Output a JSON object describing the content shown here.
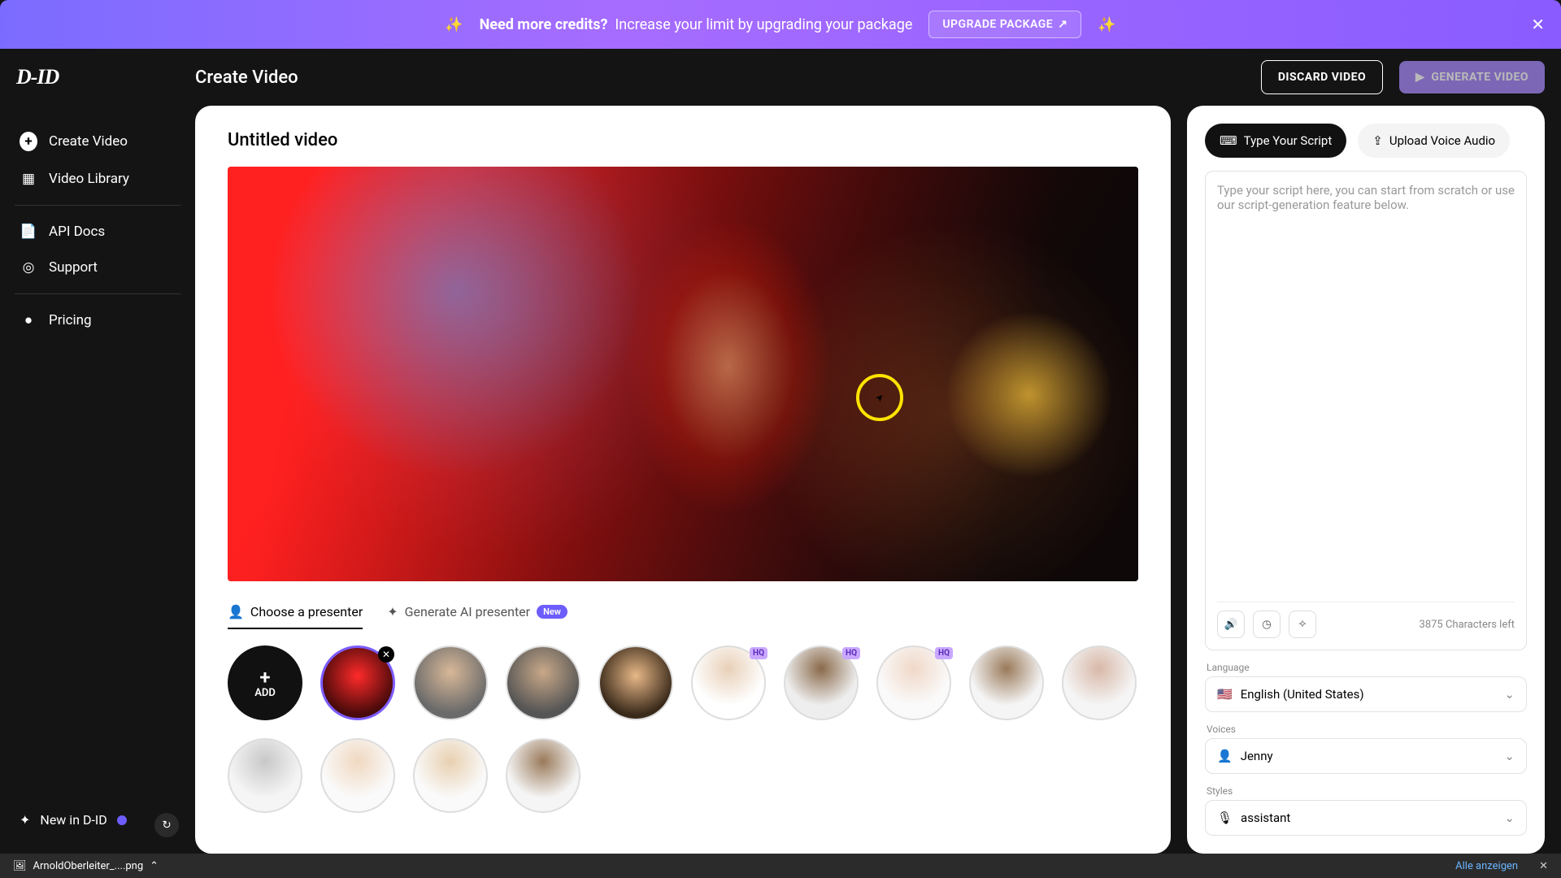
{
  "banner": {
    "bold": "Need more credits?",
    "rest": "Increase your limit by upgrading your package",
    "cta": "UPGRADE PACKAGE"
  },
  "logo": "D-ID",
  "page_title": "Create Video",
  "discard": "DISCARD VIDEO",
  "generate": "GENERATE VIDEO",
  "sidebar": {
    "create": "Create Video",
    "library": "Video Library",
    "api": "API Docs",
    "support": "Support",
    "pricing": "Pricing",
    "new_in": "New in D-ID"
  },
  "main": {
    "title": "Untitled video",
    "tab_choose": "Choose a presenter",
    "tab_generate": "Generate AI presenter",
    "new_pill": "New",
    "add": "ADD",
    "hq": "HQ"
  },
  "right": {
    "type_script": "Type Your Script",
    "upload_audio": "Upload Voice Audio",
    "placeholder": "Type your script here, you can start from scratch or use our script-generation feature below.",
    "chars_left": "3875 Characters left",
    "language_label": "Language",
    "language_value": "English (United States)",
    "flag": "🇺🇸",
    "voices_label": "Voices",
    "voices_value": "Jenny",
    "styles_label": "Styles",
    "styles_value": "assistant"
  },
  "download": {
    "filename": "ArnoldOberleiter_....png",
    "all": "Alle anzeigen"
  }
}
